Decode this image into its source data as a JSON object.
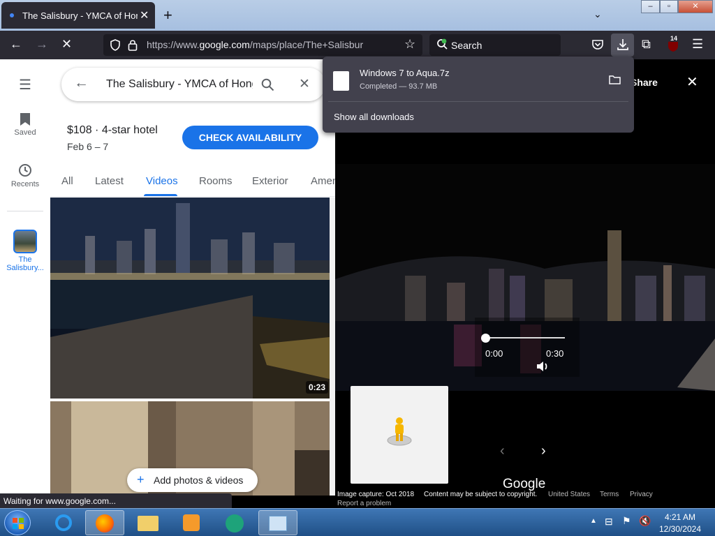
{
  "browser": {
    "tab_title": "The Salisbury - YMCA of Hong Kong",
    "url_prefix": "https://www.",
    "url_host": "google.com",
    "url_path": "/maps/place/The+Salisbury+-+YMCA",
    "search_label": "Search",
    "extension_badge": "14",
    "status_text": "Waiting for www.google.com..."
  },
  "downloads": {
    "file_name": "Windows 7 to Aqua.7z",
    "status": "Completed — 93.7 MB",
    "show_all": "Show all downloads"
  },
  "rail": {
    "saved": "Saved",
    "recents": "Recents",
    "place_line1": "The",
    "place_line2": "Salisbury..."
  },
  "panel": {
    "search_query": "The Salisbury - YMCA of Hong Kong",
    "price": "$108 · 4-star hotel",
    "dates": "Feb 6 – 7",
    "check_button": "CHECK AVAILABILITY",
    "tabs": [
      "All",
      "Latest",
      "Videos",
      "Rooms",
      "Exterior",
      "Amenities"
    ],
    "active_tab": "Videos",
    "video1_duration": "0:23",
    "add_button": "Add photos & videos"
  },
  "viewer": {
    "share": "Share",
    "time_current": "0:00",
    "time_total": "0:30",
    "progress": 0.0,
    "logo": "Google",
    "capture": "Image capture: Oct 2018",
    "copyright": "Content may be subject to copyright.",
    "region": "United States",
    "terms": "Terms",
    "privacy": "Privacy",
    "report": "Report a problem"
  },
  "taskbar": {
    "time": "4:21 AM",
    "date": "12/30/2024"
  },
  "colors": {
    "accent_blue": "#1a73e8",
    "browser_dark": "#2b2a33",
    "taskbar": "#2a5e9c"
  }
}
